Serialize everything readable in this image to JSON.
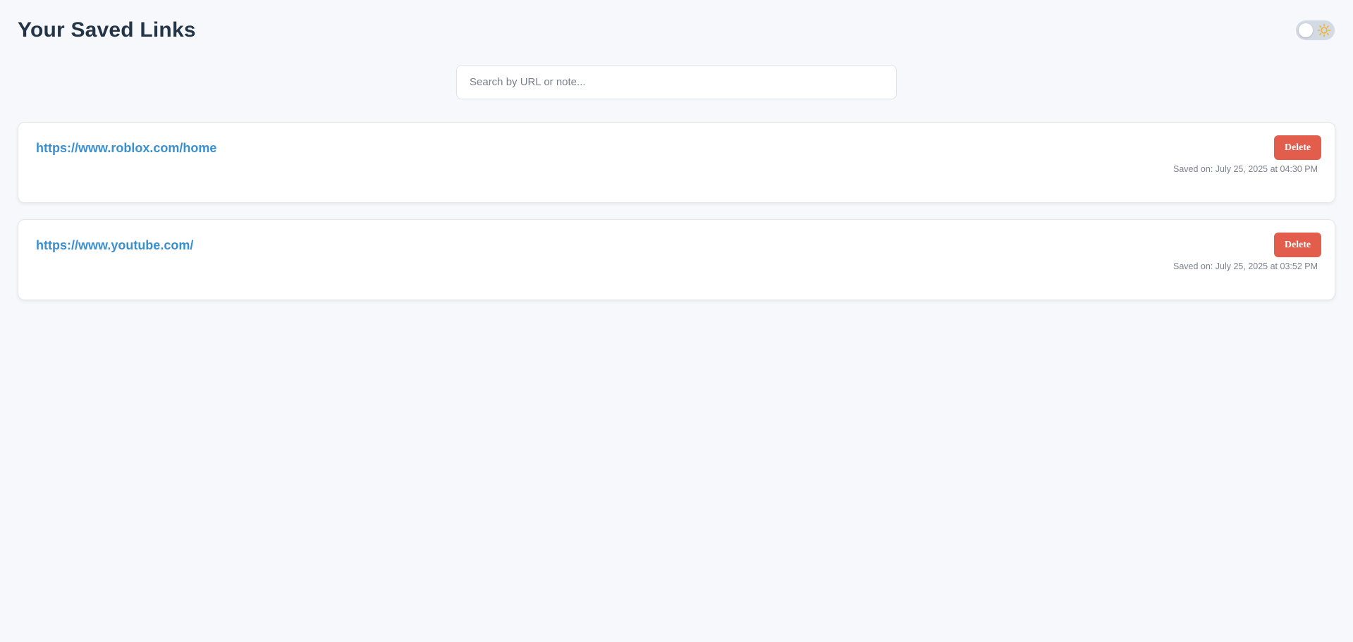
{
  "header": {
    "title": "Your Saved Links",
    "theme_toggle_icon": "sun-icon"
  },
  "search": {
    "placeholder": "Search by URL or note...",
    "value": ""
  },
  "links": [
    {
      "url": "https://www.roblox.com/home",
      "delete_label": "Delete",
      "saved_on": "Saved on: July 25, 2025 at 04:30 PM"
    },
    {
      "url": "https://www.youtube.com/",
      "delete_label": "Delete",
      "saved_on": "Saved on: July 25, 2025 at 03:52 PM"
    }
  ],
  "colors": {
    "background": "#f6f8fb",
    "title": "#243447",
    "link": "#3a8fd0",
    "delete": "#e35d4d",
    "toggle_track": "#d3dae3",
    "sun": "#f0b429"
  }
}
